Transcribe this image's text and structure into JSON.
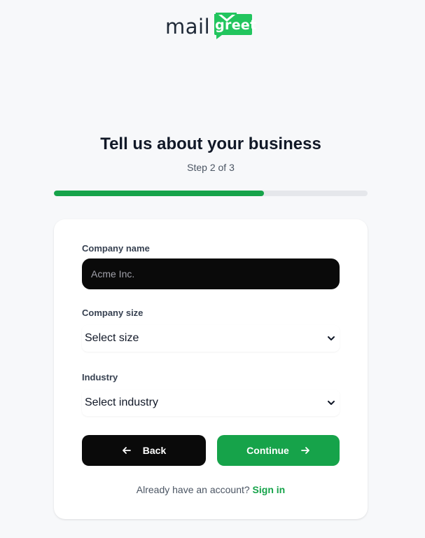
{
  "brand": {
    "word_left": "mail",
    "word_badge": "greet",
    "badge_color": "#22c55e"
  },
  "header": {
    "title": "Tell us about your business",
    "step_text": "Step 2 of 3"
  },
  "progress": {
    "fraction": 0.67,
    "fill_color": "#16a34a",
    "track_color": "#e5e7eb"
  },
  "form": {
    "company_name": {
      "label": "Company name",
      "placeholder": "Acme Inc.",
      "value": ""
    },
    "company_size": {
      "label": "Company size",
      "selected": "Select size"
    },
    "industry": {
      "label": "Industry",
      "selected": "Select industry"
    }
  },
  "actions": {
    "back_label": "Back",
    "continue_label": "Continue",
    "back_icon": "arrow-left-icon",
    "continue_icon": "arrow-right-icon"
  },
  "footer": {
    "prompt": "Already have an account?",
    "signin_label": "Sign in",
    "accent": "#16a34a"
  }
}
